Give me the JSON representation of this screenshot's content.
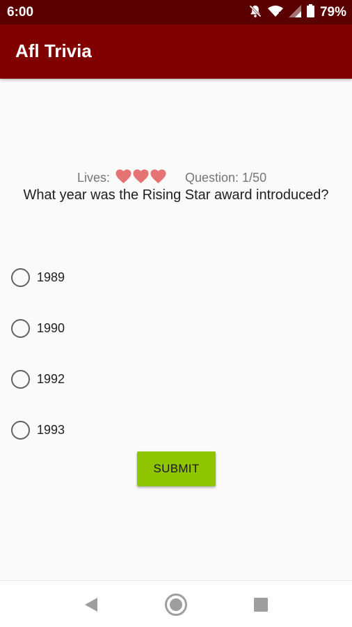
{
  "status_bar": {
    "time": "6:00",
    "battery_percent": "79%",
    "icons": [
      "notifications-off-icon",
      "wifi-icon",
      "signal-icon",
      "battery-icon"
    ]
  },
  "app_bar": {
    "title": "Afl Trivia",
    "color": "#800000"
  },
  "game": {
    "lives_label": "Lives:",
    "lives_remaining": 3,
    "heart_color": "#e57373",
    "question_counter": "Question: 1/50",
    "question": "What year was the Rising Star award introduced?"
  },
  "answers": [
    {
      "label": "1989",
      "selected": false
    },
    {
      "label": "1990",
      "selected": false
    },
    {
      "label": "1992",
      "selected": false
    },
    {
      "label": "1993",
      "selected": false
    }
  ],
  "submit": {
    "label": "SUBMIT",
    "color": "#8fc400"
  },
  "nav_bar": {
    "icons": [
      "back-icon",
      "home-icon",
      "recents-icon"
    ]
  }
}
